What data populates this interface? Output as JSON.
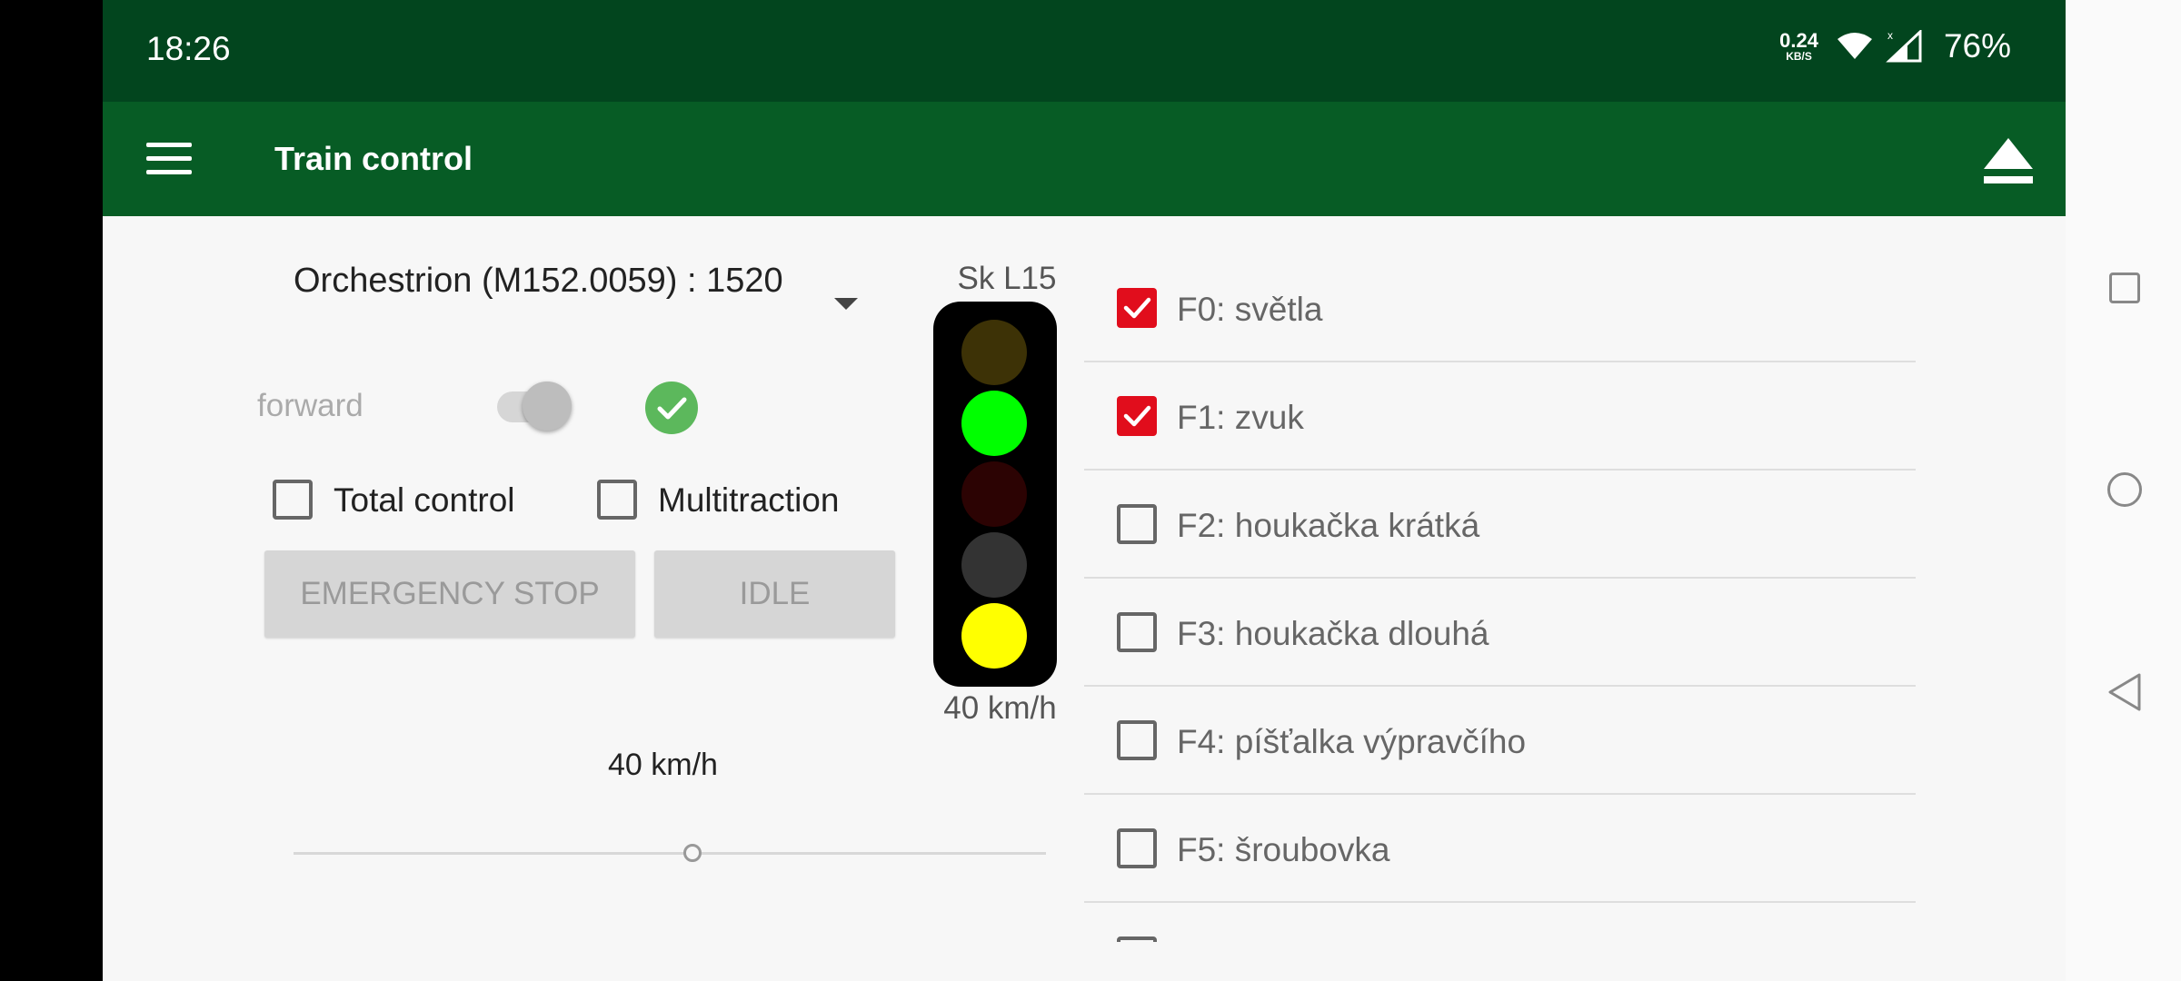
{
  "status_bar": {
    "time": "18:26",
    "net_speed_value": "0.24",
    "net_speed_unit": "KB/S",
    "battery": "76%",
    "icons": [
      "wifi-icon",
      "signal-icon",
      "battery-icon"
    ]
  },
  "app_bar": {
    "title": "Train control",
    "menu_icon": "hamburger-menu-icon",
    "action_icon": "eject-icon"
  },
  "locomotive": {
    "selected": "Orchestrion (M152.0059) : 1520"
  },
  "direction": {
    "label": "forward",
    "switch_on": false
  },
  "options": {
    "total_control": {
      "label": "Total control",
      "checked": false
    },
    "multitraction": {
      "label": "Multitraction",
      "checked": false
    }
  },
  "buttons": {
    "emergency_stop": "EMERGENCY STOP",
    "idle": "IDLE"
  },
  "speed": {
    "current_label": "40 km/h",
    "slider_fraction": 0.53
  },
  "signal": {
    "name": "Sk L15",
    "speed_label": "40 km/h",
    "lamps": [
      {
        "color": "#3d3206",
        "lit": false
      },
      {
        "color": "#00ff00",
        "lit": true
      },
      {
        "color": "#2c0303",
        "lit": false
      },
      {
        "color": "#333333",
        "lit": false
      },
      {
        "color": "#ffff00",
        "lit": true
      }
    ]
  },
  "functions": [
    {
      "label": "F0: světla",
      "checked": true
    },
    {
      "label": "F1: zvuk",
      "checked": true
    },
    {
      "label": "F2: houkačka krátká",
      "checked": false
    },
    {
      "label": "F3: houkačka dlouhá",
      "checked": false
    },
    {
      "label": "F4: píšťalka výpravčího",
      "checked": false
    },
    {
      "label": "F5: šroubovka",
      "checked": false
    }
  ],
  "colors": {
    "status_bar": "#02451e",
    "app_bar": "#075c25",
    "checkbox_checked": "#e10d1c",
    "ok_badge": "#5cb85c"
  }
}
